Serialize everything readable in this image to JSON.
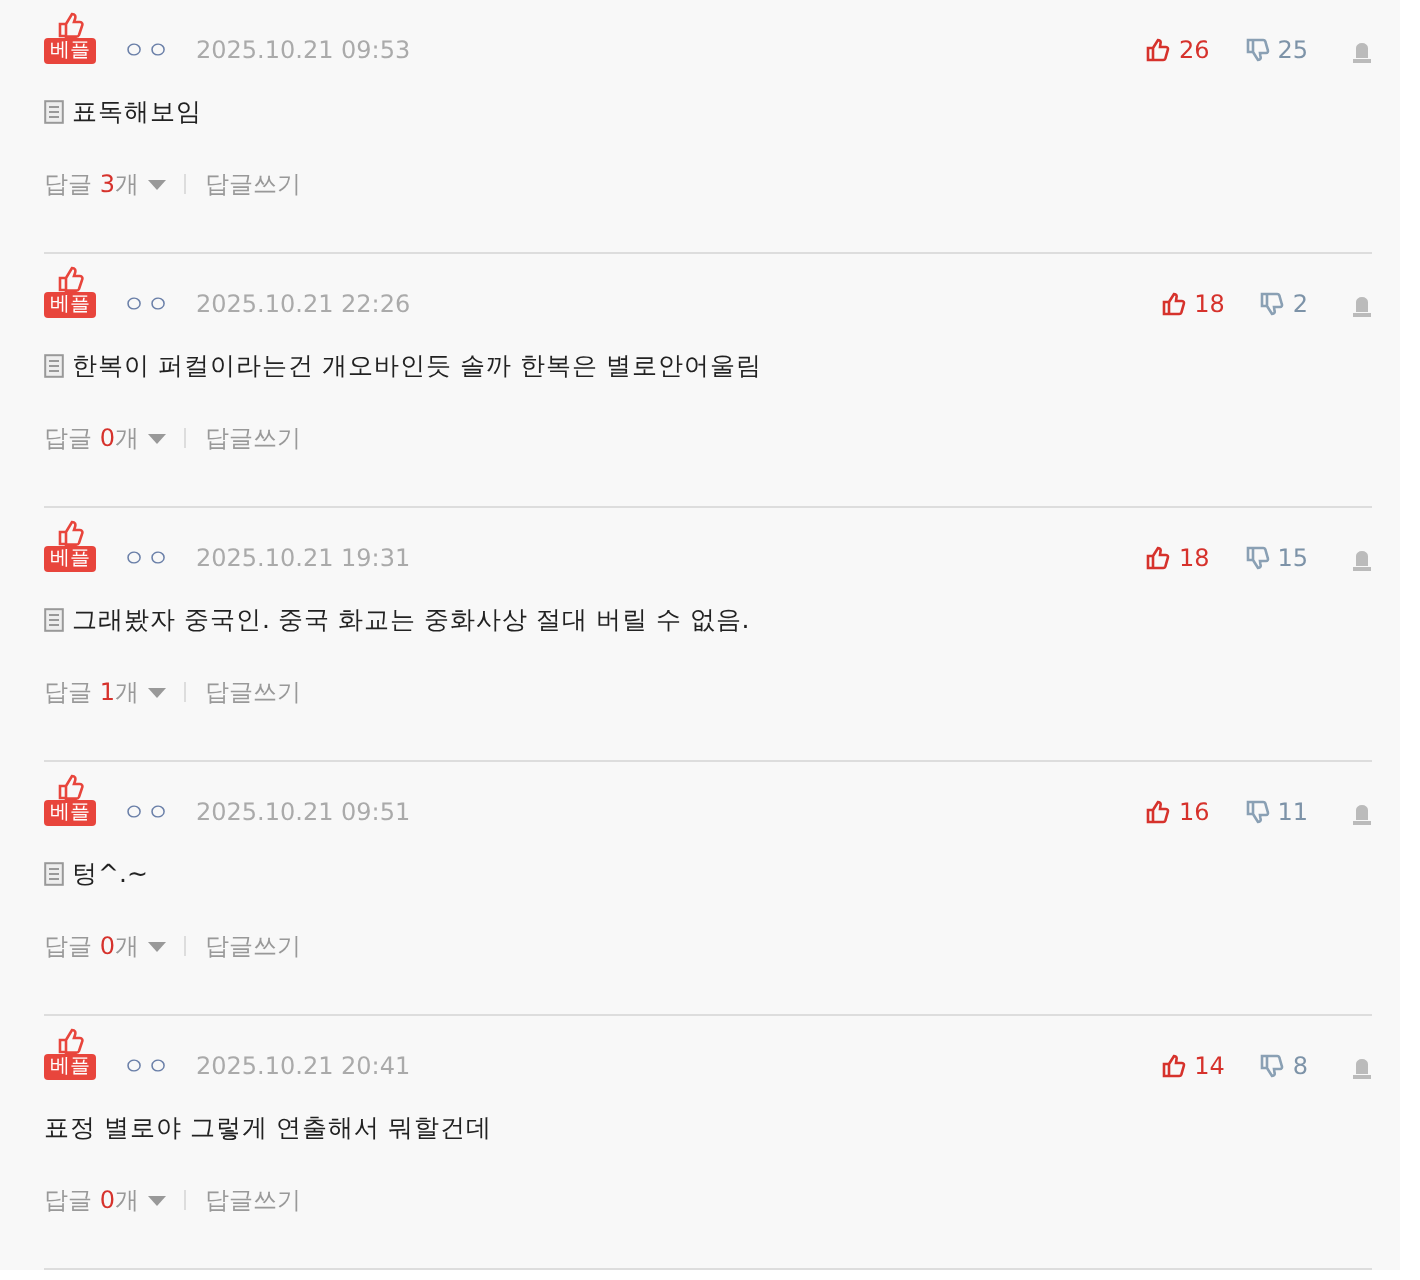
{
  "comments": [
    {
      "badge": "베플",
      "author": "ㅇㅇ",
      "date": "2025.10.21 09:53",
      "attachment": true,
      "text": "표독해보임",
      "likes": "26",
      "dislikes": "25",
      "reply_label": "답글",
      "reply_count": "3",
      "reply_unit": "개",
      "write_reply": "답글쓰기"
    },
    {
      "badge": "베플",
      "author": "ㅇㅇ",
      "date": "2025.10.21 22:26",
      "attachment": true,
      "text": "한복이 퍼컬이라는건 개오바인듯 솔까 한복은 별로안어울림",
      "likes": "18",
      "dislikes": "2",
      "reply_label": "답글",
      "reply_count": "0",
      "reply_unit": "개",
      "write_reply": "답글쓰기"
    },
    {
      "badge": "베플",
      "author": "ㅇㅇ",
      "date": "2025.10.21 19:31",
      "attachment": true,
      "text": "그래봤자 중국인. 중국 화교는 중화사상 절대 버릴 수 없음.",
      "likes": "18",
      "dislikes": "15",
      "reply_label": "답글",
      "reply_count": "1",
      "reply_unit": "개",
      "write_reply": "답글쓰기"
    },
    {
      "badge": "베플",
      "author": "ㅇㅇ",
      "date": "2025.10.21 09:51",
      "attachment": true,
      "text": "텅^.~",
      "likes": "16",
      "dislikes": "11",
      "reply_label": "답글",
      "reply_count": "0",
      "reply_unit": "개",
      "write_reply": "답글쓰기"
    },
    {
      "badge": "베플",
      "author": "ㅇㅇ",
      "date": "2025.10.21 20:41",
      "attachment": false,
      "text": "표정 별로야 그렇게 연출해서 뭐할건데",
      "likes": "14",
      "dislikes": "8",
      "reply_label": "답글",
      "reply_count": "0",
      "reply_unit": "개",
      "write_reply": "답글쓰기"
    }
  ]
}
